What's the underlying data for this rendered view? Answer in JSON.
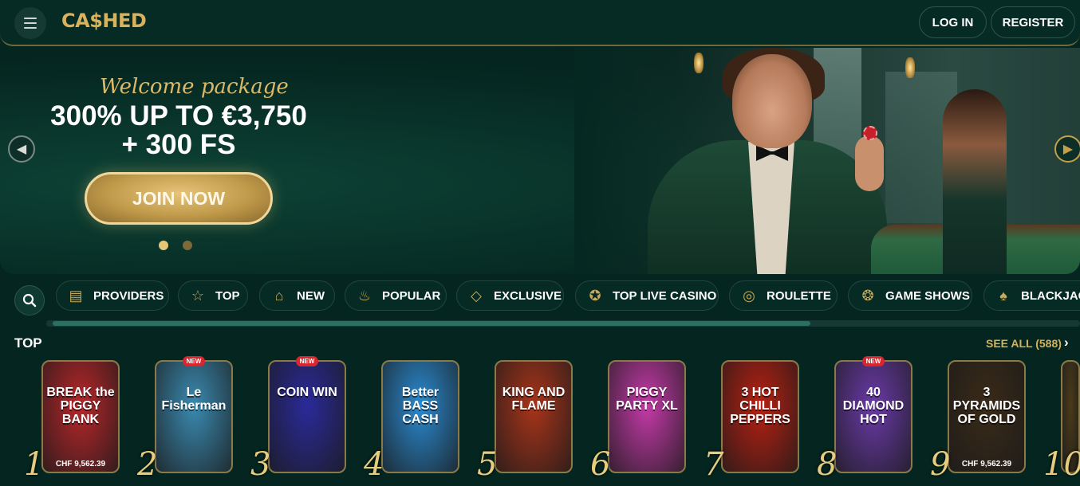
{
  "header": {
    "logo": "CA$HED",
    "login_label": "LOG IN",
    "register_label": "REGISTER"
  },
  "hero": {
    "welcome": "Welcome package",
    "headline_line1": "300% UP TO €3,750",
    "headline_line2": "+ 300 FS",
    "cta_label": "JOIN NOW",
    "slides_total": 2,
    "active_slide": 1
  },
  "categories": [
    {
      "label": "PROVIDERS",
      "icon": "book-icon"
    },
    {
      "label": "TOP",
      "icon": "star-icon"
    },
    {
      "label": "NEW",
      "icon": "gift-icon"
    },
    {
      "label": "POPULAR",
      "icon": "flame-icon"
    },
    {
      "label": "EXCLUSIVE",
      "icon": "diamond-icon"
    },
    {
      "label": "TOP LIVE CASINO",
      "icon": "medal-icon"
    },
    {
      "label": "ROULETTE",
      "icon": "roulette-icon"
    },
    {
      "label": "GAME SHOWS",
      "icon": "wheel-icon"
    },
    {
      "label": "BLACKJAC",
      "icon": "cards-icon"
    }
  ],
  "top_section": {
    "title": "TOP",
    "see_all": "SEE ALL (588)"
  },
  "games": [
    {
      "rank": "1",
      "title": "BREAK the PIGGY BANK",
      "price": "CHF 9,562.39",
      "badge": "",
      "color": "#b8262a"
    },
    {
      "rank": "2",
      "title": "Le Fisherman",
      "price": "",
      "badge": "NEW",
      "color": "#3a8ab0"
    },
    {
      "rank": "3",
      "title": "COIN WIN",
      "price": "",
      "badge": "NEW",
      "color": "#2a2a9a"
    },
    {
      "rank": "4",
      "title": "Better BASS CASH",
      "price": "",
      "badge": "",
      "color": "#2a8ad0"
    },
    {
      "rank": "5",
      "title": "KING AND FLAME",
      "price": "",
      "badge": "",
      "color": "#a8341a"
    },
    {
      "rank": "6",
      "title": "PIGGY PARTY XL",
      "price": "",
      "badge": "",
      "color": "#c43aa8"
    },
    {
      "rank": "7",
      "title": "3 HOT CHILLI PEPPERS",
      "price": "",
      "badge": "",
      "color": "#b82012"
    },
    {
      "rank": "8",
      "title": "40 DIAMOND HOT",
      "price": "",
      "badge": "NEW",
      "color": "#6a3aa8"
    },
    {
      "rank": "9",
      "title": "3 PYRAMIDS OF GOLD",
      "price": "CHF 9,562.39",
      "badge": "",
      "color": "#3a2a18"
    },
    {
      "rank": "10",
      "title": "",
      "price": "",
      "badge": "",
      "color": "#4a3a1a"
    }
  ]
}
